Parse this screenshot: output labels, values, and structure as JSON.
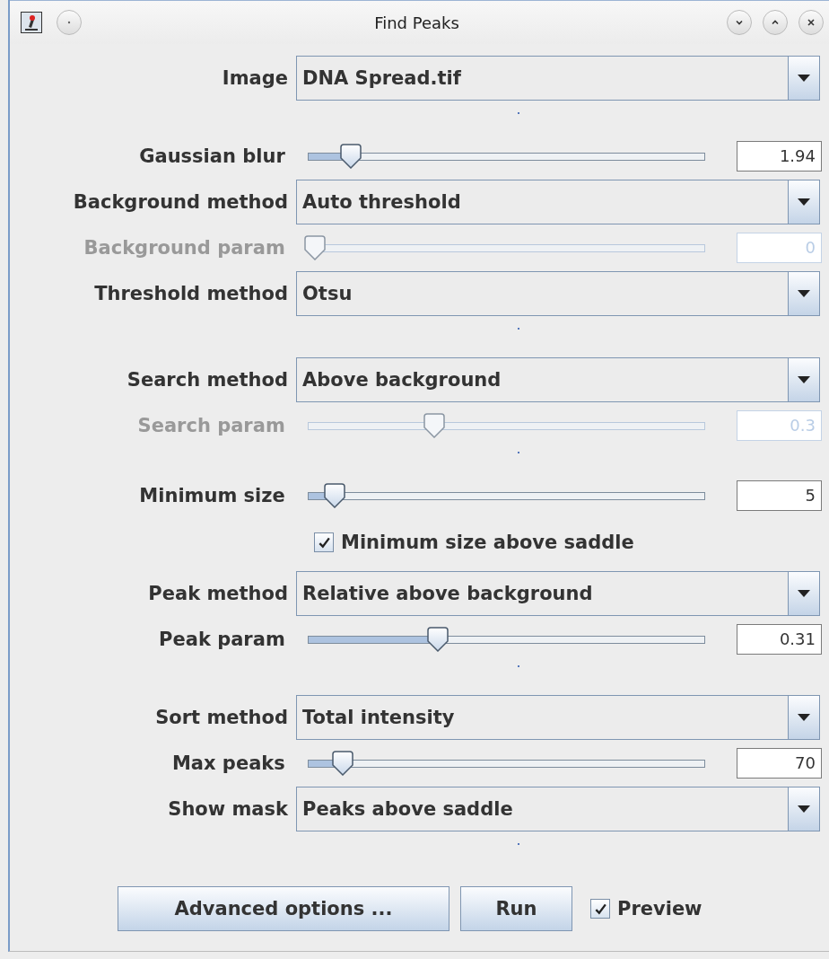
{
  "window": {
    "title": "Find Peaks"
  },
  "fields": [
    {
      "kind": "dropdown",
      "label": "Image",
      "value": "DNA Spread.tif"
    },
    {
      "kind": "divider"
    },
    {
      "kind": "slider",
      "label": "Gaussian blur",
      "level": 0.09,
      "value": "1.94",
      "disabled": false
    },
    {
      "kind": "dropdown",
      "label": "Background method",
      "value": "Auto threshold"
    },
    {
      "kind": "slider",
      "label": "Background param",
      "level": 0,
      "value": "0",
      "disabled": true
    },
    {
      "kind": "dropdown",
      "label": "Threshold method",
      "value": "Otsu"
    },
    {
      "kind": "divider"
    },
    {
      "kind": "dropdown",
      "label": "Search method",
      "value": "Above background"
    },
    {
      "kind": "slider",
      "label": "Search param",
      "level": 0.3,
      "value": "0.3",
      "disabled": true
    },
    {
      "kind": "divider"
    },
    {
      "kind": "slider",
      "label": "Minimum size",
      "level": 0.05,
      "value": "5",
      "disabled": false
    },
    {
      "kind": "checkbox",
      "label": "Minimum size above saddle",
      "checked": true
    },
    {
      "kind": "dropdown",
      "label": "Peak method",
      "value": "Relative above background"
    },
    {
      "kind": "slider",
      "label": "Peak param",
      "level": 0.31,
      "value": "0.31",
      "disabled": false
    },
    {
      "kind": "divider"
    },
    {
      "kind": "dropdown",
      "label": "Sort method",
      "value": "Total intensity"
    },
    {
      "kind": "slider",
      "label": "Max peaks",
      "level": 0.07,
      "value": "70",
      "disabled": false
    },
    {
      "kind": "dropdown",
      "label": "Show mask",
      "value": "Peaks above saddle"
    },
    {
      "kind": "divider"
    }
  ],
  "buttons": [
    "Advanced options ...",
    "Run"
  ],
  "preview": {
    "label": "Preview",
    "checked": true
  }
}
